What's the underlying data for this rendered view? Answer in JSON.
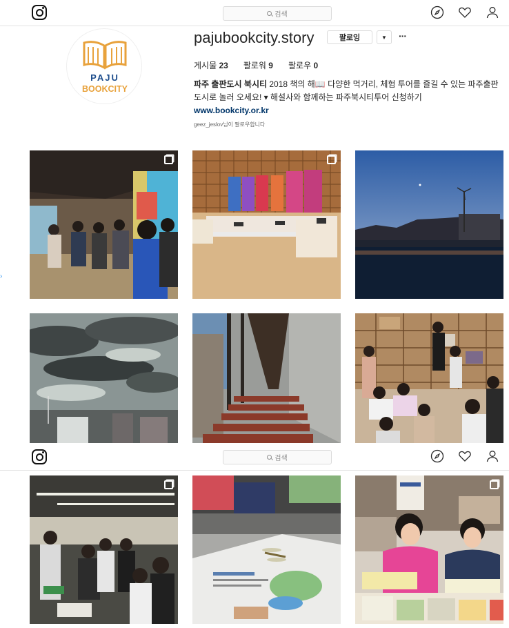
{
  "search": {
    "placeholder": "검색"
  },
  "profile": {
    "username": "pajubookcity.story",
    "follow_label": "팔로잉",
    "dropdown_label": "▼",
    "more_label": "···",
    "stats": {
      "posts_label": "게시물",
      "posts": "23",
      "followers_label": "팔로워",
      "followers": "9",
      "following_label": "팔로우",
      "following": "0"
    },
    "bio_name": "파주 출판도시 북시티",
    "bio_text": " 2018 책의 해📖 다양한 먹거리, 체험 투어를 즐길 수 있는 파주출판도시로 놀러 오세요! ▾ 해설사와 함께하는 파주북시티투어 신청하기",
    "bio_link": "www.bookcity.or.kr",
    "followed_by_user": "geez_jeslov",
    "followed_by_suffix": "님이 팔로우합니다",
    "avatar_logo_line1": "PAJU",
    "avatar_logo_line2": "BOOKCITY"
  },
  "icons": [
    "instagram-logo-icon",
    "compass-icon",
    "heart-icon",
    "user-icon",
    "search-icon",
    "multi-image-icon"
  ],
  "colors": {
    "link": "#003569",
    "logo_orange": "#e8a23c",
    "logo_blue": "#1d4d8c"
  },
  "posts": [
    {
      "id": "post-1",
      "subject": "crowd in bookstore hall",
      "multi": true
    },
    {
      "id": "post-2",
      "subject": "book exhibition display",
      "multi": true
    },
    {
      "id": "post-3",
      "subject": "sunset skyline with wind turbine",
      "multi": false
    },
    {
      "id": "post-4",
      "subject": "cloudy sky over buildings",
      "multi": false
    },
    {
      "id": "post-5",
      "subject": "concrete stairway corridor",
      "multi": false
    },
    {
      "id": "post-6",
      "subject": "students in library bookshelves",
      "multi": false
    },
    {
      "id": "post-7",
      "subject": "book warehouse visit",
      "multi": true
    },
    {
      "id": "post-8",
      "subject": "dragonfly on map booklet",
      "multi": false
    },
    {
      "id": "post-9",
      "subject": "children reading comic books",
      "multi": true
    }
  ]
}
